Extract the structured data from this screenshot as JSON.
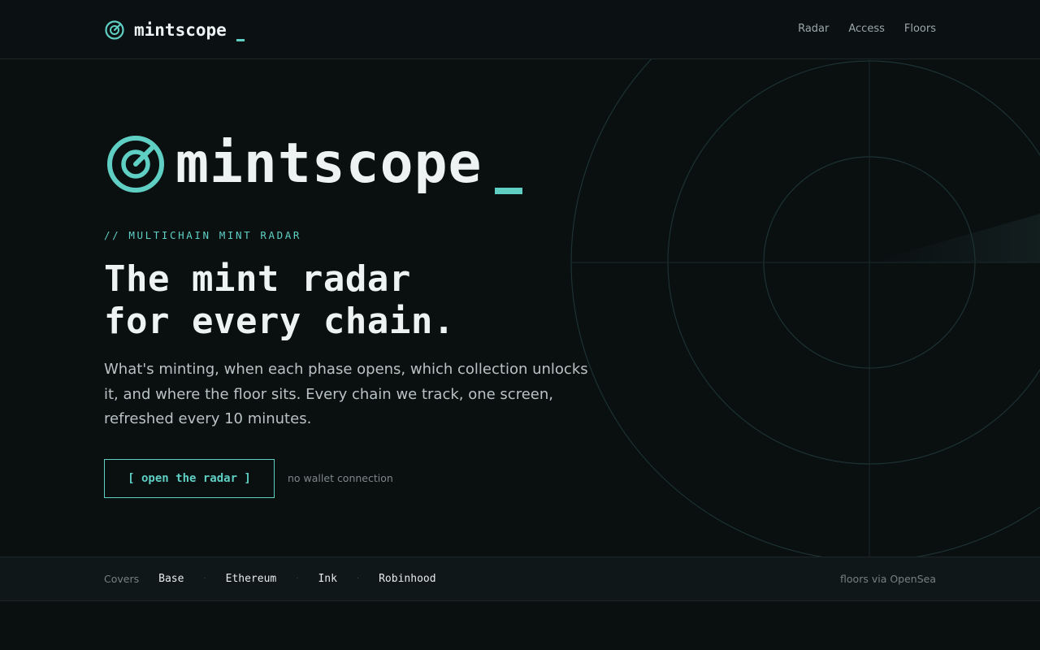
{
  "brand": {
    "name": "mintscope",
    "accent_color": "#5fcfc4",
    "icon": "radar-icon"
  },
  "nav": {
    "items": [
      {
        "label": "Radar"
      },
      {
        "label": "Access"
      },
      {
        "label": "Floors"
      }
    ]
  },
  "hero": {
    "logo_name": "mintscope",
    "eyebrow": "// MULTICHAIN MINT RADAR",
    "headline_line1": "The mint radar",
    "headline_line2": "for every chain.",
    "lede": "What's minting, when each phase opens, which collection unlocks it, and where the floor sits. Every chain we track, one screen, refreshed every 10 minutes.",
    "cta_label": "[ open the radar ]",
    "cta_note": "no wallet connection"
  },
  "strip": {
    "covers_label": "Covers",
    "chains": [
      "Base",
      "Ethereum",
      "Ink",
      "Robinhood"
    ],
    "separator": "·",
    "source": "floors via OpenSea"
  }
}
